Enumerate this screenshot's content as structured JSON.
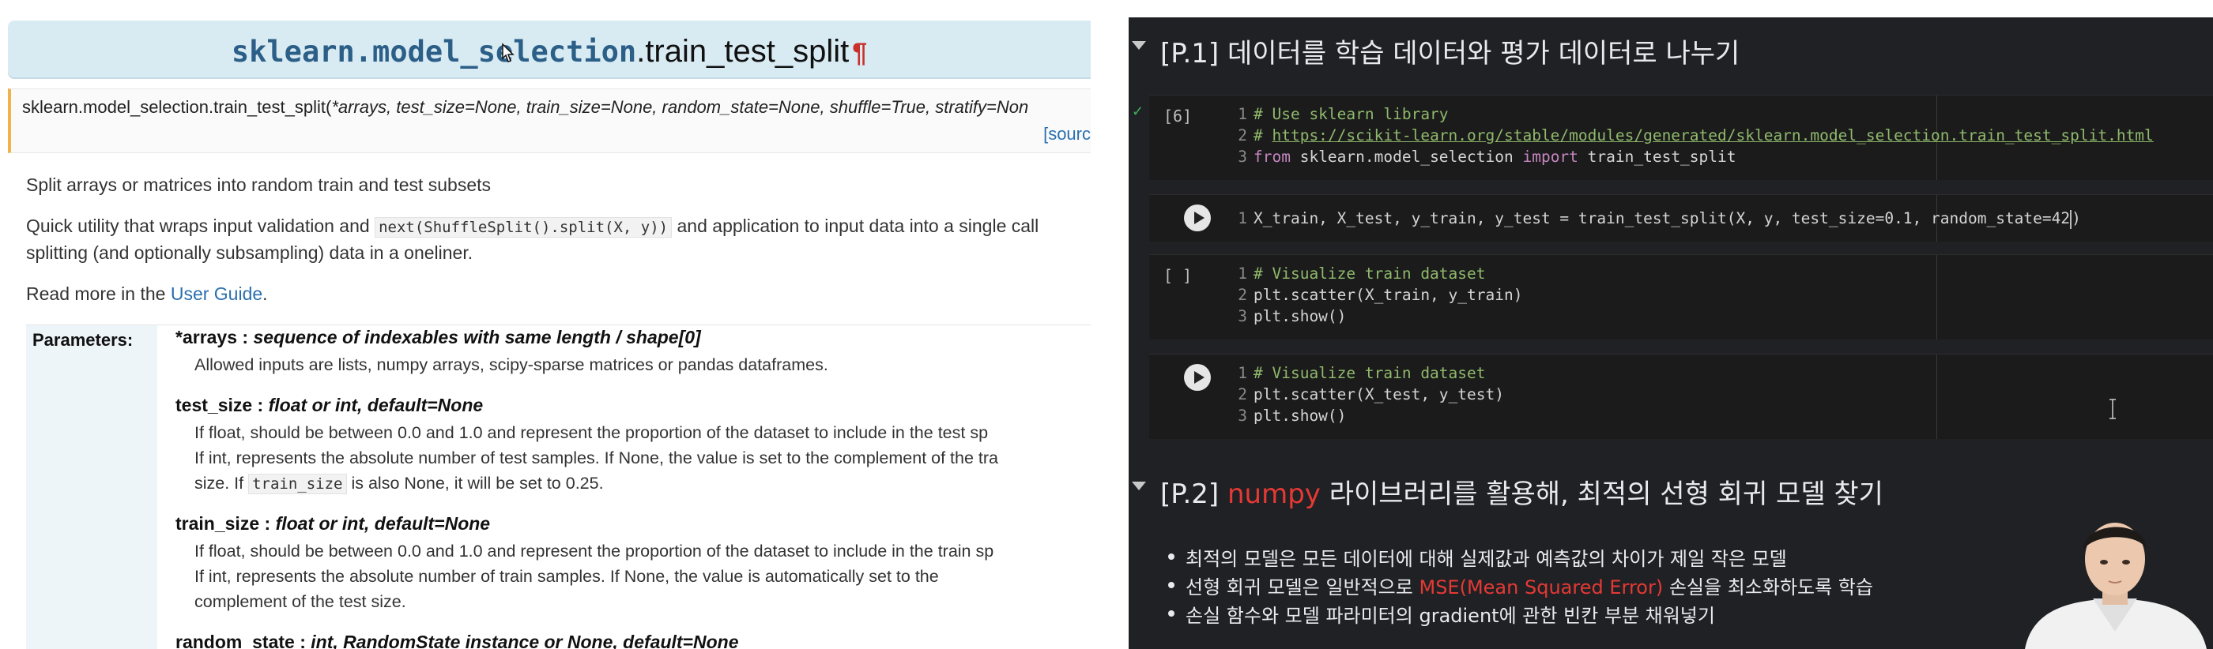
{
  "doc": {
    "title_module": "sklearn.model_selection",
    "title_function": ".train_test_split",
    "title_pilcrow": "¶",
    "signature_prefix": "sklearn.model_selection.train_test_split(",
    "signature_args": "*arrays, test_size=None, train_size=None, random_state=None, shuffle=True, stratify=Non",
    "source_link": "[sourc",
    "summary": "Split arrays or matrices into random train and test subsets",
    "utility_before": "Quick utility that wraps input validation and ",
    "utility_code": "next(ShuffleSplit().split(X, y))",
    "utility_after": " and application to input data into a single call",
    "utility_line2": "splitting (and optionally subsampling) data in a oneliner.",
    "read_more_before": "Read more in the ",
    "read_more_link": "User Guide",
    "read_more_after": ".",
    "parameters_label": "Parameters:",
    "params": [
      {
        "name": "*arrays",
        "sep": " : ",
        "type": "sequence of indexables with same length / shape[0]",
        "lines": [
          "Allowed inputs are lists, numpy arrays, scipy-sparse matrices or pandas dataframes."
        ]
      },
      {
        "name": "test_size",
        "sep": " : ",
        "type": "float or int, default=None",
        "lines": [
          "If float, should be between 0.0 and 1.0 and represent the proportion of the dataset to include in the test sp",
          "If int, represents the absolute number of test samples. If None, the value is set to the complement of the tra"
        ],
        "line3_before": "size. If ",
        "line3_code": "train_size",
        "line3_after": " is also None, it will be set to 0.25."
      },
      {
        "name": "train_size",
        "sep": " : ",
        "type": "float or int, default=None",
        "lines": [
          "If float, should be between 0.0 and 1.0 and represent the proportion of the dataset to include in the train sp",
          "If int, represents the absolute number of train samples. If None, the value is automatically set to the",
          "complement of the test size."
        ]
      },
      {
        "name": "random_state",
        "sep": " : ",
        "type": "int, RandomState instance or None, default=None",
        "lines": []
      }
    ]
  },
  "notebook": {
    "section1": {
      "title": "[P.1] 데이터를 학습 데이터와 평가 데이터로 나누기"
    },
    "cells": [
      {
        "exec": "[6]",
        "lines": [
          {
            "n": "1",
            "comment": "# Use sklearn library"
          },
          {
            "n": "2",
            "comment": "# ",
            "url": "https://scikit-learn.org/stable/modules/generated/sklearn.model_selection.train_test_split.html"
          },
          {
            "n": "3",
            "kw1": "from",
            "mod": " sklearn.model_selection ",
            "kw2": "import",
            "rest": " train_test_split"
          }
        ]
      },
      {
        "lines": [
          {
            "n": "1",
            "before": "X_train, X_test, y_train, y_test = train_test_split(",
            "mid": "X, y, test_size=0.1, random_state=42",
            "after": ")"
          }
        ]
      },
      {
        "exec": "[ ]",
        "lines": [
          {
            "n": "1",
            "comment": "# Visualize train dataset"
          },
          {
            "n": "2",
            "code": "plt.scatter(X_train, y_train)"
          },
          {
            "n": "3",
            "code": "plt.show()"
          }
        ]
      },
      {
        "lines": [
          {
            "n": "1",
            "comment": "# Visualize train dataset"
          },
          {
            "n": "2",
            "code": "plt.scatter(X_test, y_test)"
          },
          {
            "n": "3",
            "code": "plt.show()"
          }
        ]
      }
    ],
    "section2": {
      "prefix": "[P.2] ",
      "highlight": "numpy",
      "rest": " 라이브러리를 활용해, 최적의 선형 회귀 모델 찾기"
    },
    "bullets": [
      {
        "text": "최적의 모델은 모든 데이터에 대해 실제값과 예측값의 차이가 제일 작은 모델"
      },
      {
        "before": "선형 회귀 모델은 일반적으로 ",
        "highlight": "MSE(Mean Squared Error)",
        "after": " 손실을 최소화하도록 학습"
      },
      {
        "text": "손실 함수와 모델 파라미터의 gradient에 관한 빈칸 부분 채워넣기"
      }
    ]
  },
  "colors": {
    "doc_title_bg": "#d8ebf3",
    "module_text": "#2c5f87",
    "pilcrow": "#c9302c",
    "signature_accent": "#f0b24b",
    "link": "#2a6fb0",
    "notebook_bg": "#202124",
    "cell_bg": "#1b1b1b",
    "comment_green": "#8fb96c",
    "keyword_purple": "#c586c0",
    "highlight_red": "#e53935"
  },
  "icons": [
    "pointer-cursor-icon",
    "collapse-chevron-icon",
    "run-cell-icon",
    "executed-check-icon",
    "text-cursor-icon"
  ]
}
